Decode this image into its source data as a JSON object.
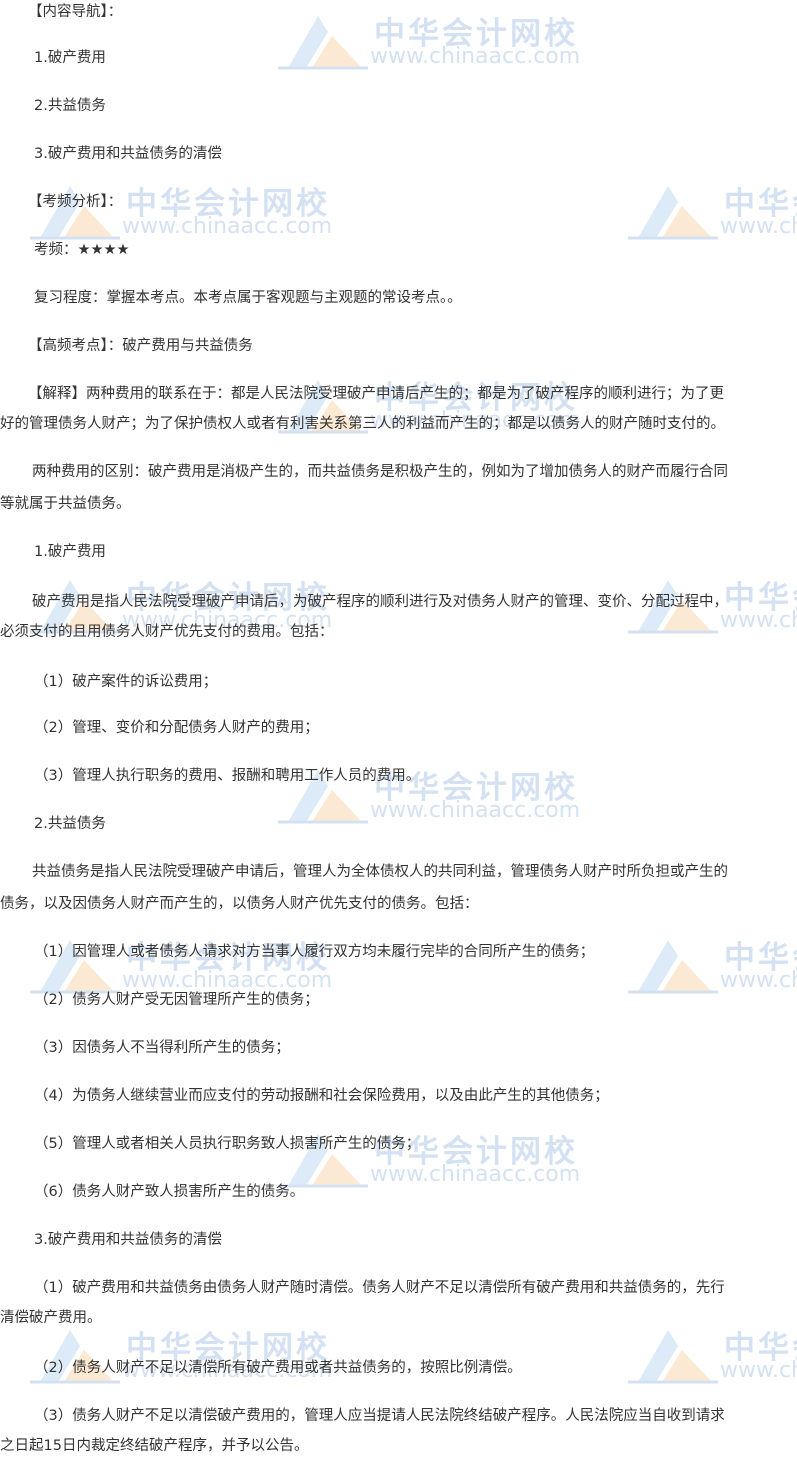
{
  "watermark": {
    "name": "中华会计网校",
    "url": "www.chinaacc.com"
  },
  "lines": [
    "【内容导航】：",
    "1.破产费用",
    "2.共益债务",
    "3.破产费用和共益债务的清偿",
    "【考频分析】：",
    "考频：★★★★",
    "复习程度：掌握本考点。本考点属于客观题与主观题的常设考点。。",
    "【高频考点】：破产费用与共益债务",
    "【解释】两种费用的联系在于：都是人民法院受理破产申请后产生的；都是为了破产程序的顺利进行；为了更",
    "好的管理债务人财产；为了保护债权人或者有利害关系第三人的利益而产生的；都是以债务人的财产随时支付的。",
    "两种费用的区别：破产费用是消极产生的，而共益债务是积极产生的，例如为了增加债务人的财产而履行合同",
    "等就属于共益债务。",
    "1.破产费用",
    "破产费用是指人民法院受理破产申请后，为破产程序的顺利进行及对债务人财产的管理、变价、分配过程中，",
    "必须支付的且用债务人财产优先支付的费用。包括：",
    "（1）破产案件的诉讼费用；",
    "（2）管理、变价和分配债务人财产的费用；",
    "（3）管理人执行职务的费用、报酬和聘用工作人员的费用。",
    "2.共益债务",
    "共益债务是指人民法院受理破产申请后，管理人为全体债权人的共同利益，管理债务人财产时所负担或产生的",
    "债务，以及因债务人财产而产生的，以债务人财产优先支付的债务。包括：",
    "（1）因管理人或者债务人请求对方当事人履行双方均未履行完毕的合同所产生的债务；",
    "（2）债务人财产受无因管理所产生的债务；",
    "（3）因债务人不当得利所产生的债务；",
    "（4）为债务人继续营业而应支付的劳动报酬和社会保险费用，以及由此产生的其他债务；",
    "（5）管理人或者相关人员执行职务致人损害所产生的债务；",
    "（6）债务人财产致人损害所产生的债务。",
    "3.破产费用和共益债务的清偿",
    "（1）破产费用和共益债务由债务人财产随时清偿。债务人财产不足以清偿所有破产费用和共益债务的，先行",
    "清偿破产费用。",
    "（2）债务人财产不足以清偿所有破产费用或者共益债务的，按照比例清偿。",
    "（3）债务人财产不足以清偿破产费用的，管理人应当提请人民法院终结破产程序。人民法院应当自收到请求",
    "之日起15日内裁定终结破产程序，并予以公告。"
  ]
}
